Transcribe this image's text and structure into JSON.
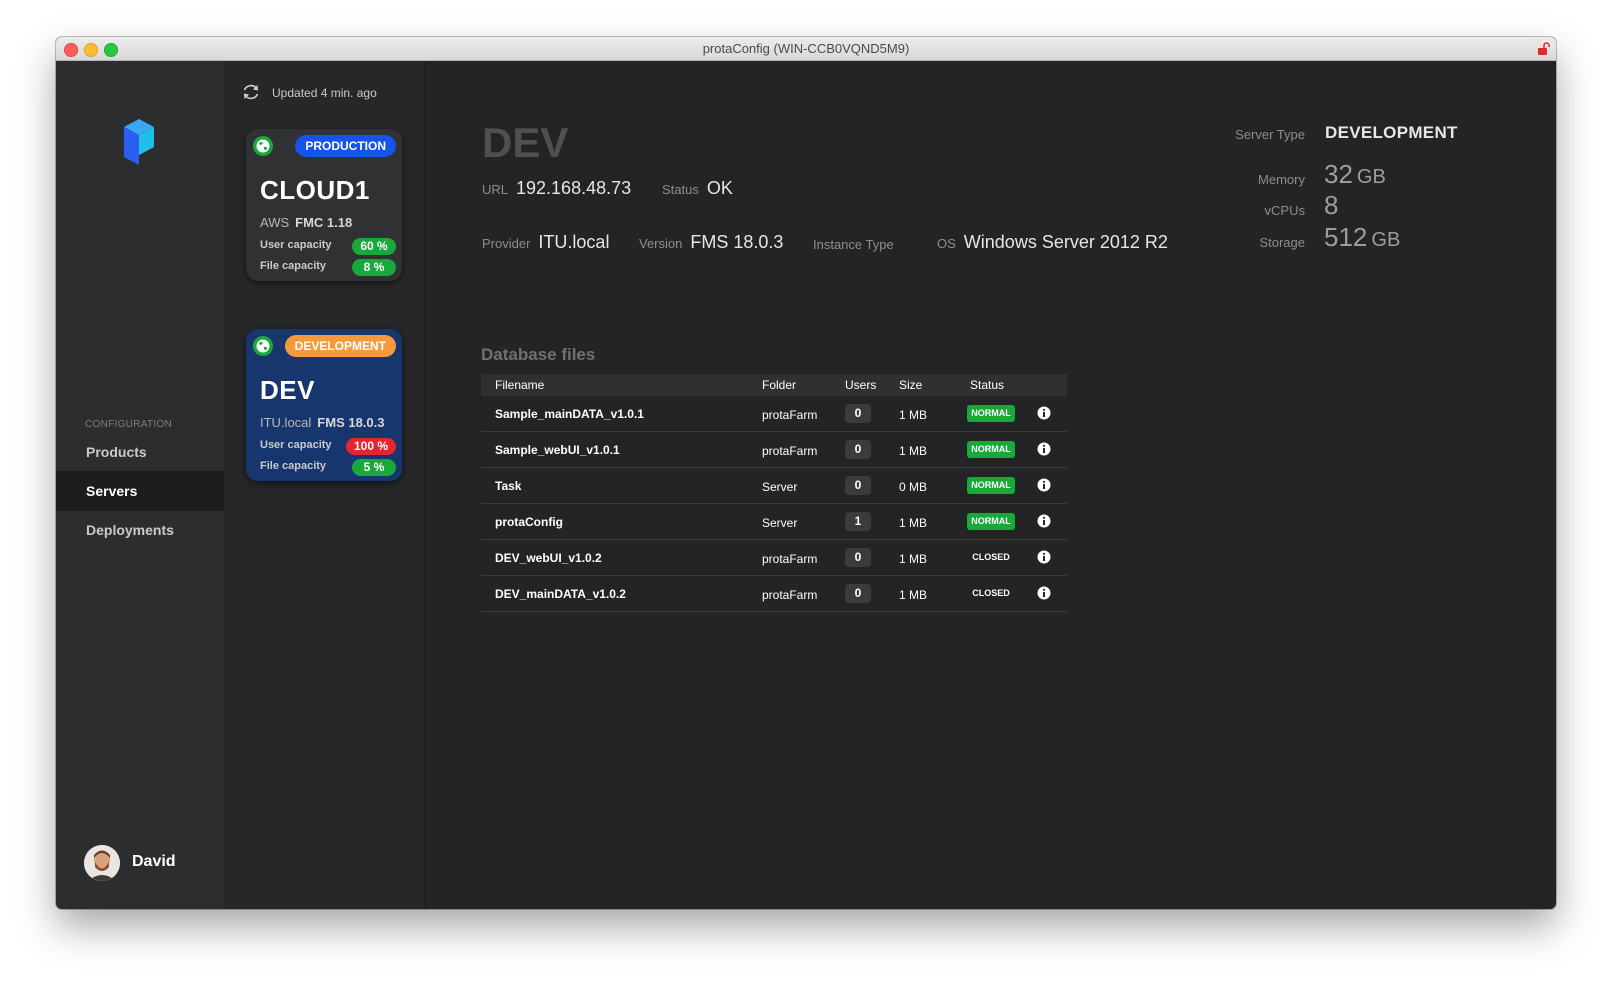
{
  "window": {
    "title": "protaConfig (WIN-CCB0VQND5M9)"
  },
  "sidebar": {
    "section_label": "CONFIGURATION",
    "items": [
      {
        "label": "Products",
        "active": false
      },
      {
        "label": "Servers",
        "active": true
      },
      {
        "label": "Deployments",
        "active": false
      }
    ],
    "user": {
      "name": "David"
    }
  },
  "servers": {
    "updated_text": "Updated 4 min. ago",
    "cards": [
      {
        "type": "PRODUCTION",
        "name": "CLOUD1",
        "provider": "AWS",
        "version": "FMC 1.18",
        "user_capacity_label": "User capacity",
        "user_capacity": "60 %",
        "file_capacity_label": "File capacity",
        "file_capacity": "8 %"
      },
      {
        "type": "DEVELOPMENT",
        "name": "DEV",
        "provider": "ITU.local",
        "version": "FMS 18.0.3",
        "user_capacity_label": "User capacity",
        "user_capacity": "100 %",
        "file_capacity_label": "File capacity",
        "file_capacity": "5 %"
      }
    ]
  },
  "detail": {
    "title": "DEV",
    "url_label": "URL",
    "url": "192.168.48.73",
    "status_label": "Status",
    "status": "OK",
    "provider_label": "Provider",
    "provider": "ITU.local",
    "version_label": "Version",
    "version": "FMS 18.0.3",
    "instance_type_label": "Instance Type",
    "os_label": "OS",
    "os": "Windows Server 2012 R2",
    "server_type_label": "Server Type",
    "server_type": "DEVELOPMENT",
    "memory_label": "Memory",
    "memory_value": "32",
    "memory_unit": "GB",
    "vcpus_label": "vCPUs",
    "vcpus": "8",
    "storage_label": "Storage",
    "storage_value": "512",
    "storage_unit": "GB"
  },
  "database": {
    "title": "Database files",
    "columns": [
      "Filename",
      "Folder",
      "Users",
      "Size",
      "Status"
    ],
    "rows": [
      {
        "filename": "Sample_mainDATA_v1.0.1",
        "folder": "protaFarm",
        "users": "0",
        "size": "1 MB",
        "status": "NORMAL"
      },
      {
        "filename": "Sample_webUI_v1.0.1",
        "folder": "protaFarm",
        "users": "0",
        "size": "1 MB",
        "status": "NORMAL"
      },
      {
        "filename": "Task",
        "folder": "Server",
        "users": "0",
        "size": "0 MB",
        "status": "NORMAL"
      },
      {
        "filename": "protaConfig",
        "folder": "Server",
        "users": "1",
        "size": "1 MB",
        "status": "NORMAL"
      },
      {
        "filename": "DEV_webUI_v1.0.2",
        "folder": "protaFarm",
        "users": "0",
        "size": "1 MB",
        "status": "CLOSED"
      },
      {
        "filename": "DEV_mainDATA_v1.0.2",
        "folder": "protaFarm",
        "users": "0",
        "size": "1 MB",
        "status": "CLOSED"
      }
    ]
  },
  "colors": {
    "production_pill": "#1554e8",
    "development_pill": "#f49a3b",
    "ok_green": "#19a83a",
    "alert_red": "#e4242f",
    "dev_card_bg": "#18366e"
  }
}
